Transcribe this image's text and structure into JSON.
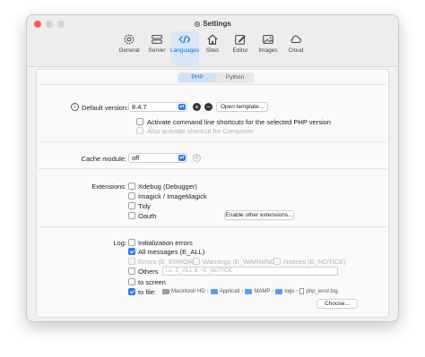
{
  "window": {
    "title": "Settings"
  },
  "toolbar": {
    "items": [
      {
        "label": "General",
        "icon": "gear-icon"
      },
      {
        "label": "Server",
        "icon": "server-icon"
      },
      {
        "label": "Languages",
        "icon": "code-icon",
        "active": true
      },
      {
        "label": "Sites",
        "icon": "house-icon"
      },
      {
        "label": "Editor",
        "icon": "edit-icon"
      },
      {
        "label": "Images",
        "icon": "image-icon"
      },
      {
        "label": "Cloud",
        "icon": "cloud-icon"
      }
    ]
  },
  "tabs": {
    "php": "PHP",
    "python": "Python",
    "active": "PHP"
  },
  "php": {
    "default_version_label": "Default version:",
    "default_version_value": "8.4.7",
    "open_template_button": "Open template...",
    "cmdline_shortcuts_label": "Activate command line shortcuts for the selected PHP version",
    "composer_shortcut_label": "Also activate shortcut for Composer",
    "cache_module_label": "Cache module:",
    "cache_module_value": "off",
    "extensions_label": "Extensions:",
    "extensions": [
      "Xdebug (Debugger)",
      "Imagick / ImageMagick",
      "Tidy",
      "Oauth"
    ],
    "enable_other_extensions_button": "Enable other extensions...",
    "log_label": "Log:",
    "log_options": {
      "init_errors": "Initialization errors",
      "all_messages": "All messages (E_ALL)",
      "errors": "Errors (E_ERROR)",
      "warnings": "Warnings (E_WARNING)",
      "notices": "Notices (E_NOTICE)",
      "others": "Others",
      "others_placeholder": "i.e. E_ALL & ~E_NOTICE",
      "to_screen": "to screen",
      "to_file": "to file:"
    },
    "log_path": [
      "Macintosh HD",
      "Applicati",
      "MAMP",
      "logs",
      "php_error.log"
    ],
    "choose_button": "Choose..."
  },
  "colors": {
    "accent": "#2f7ae5",
    "close": "#ff5f57"
  }
}
